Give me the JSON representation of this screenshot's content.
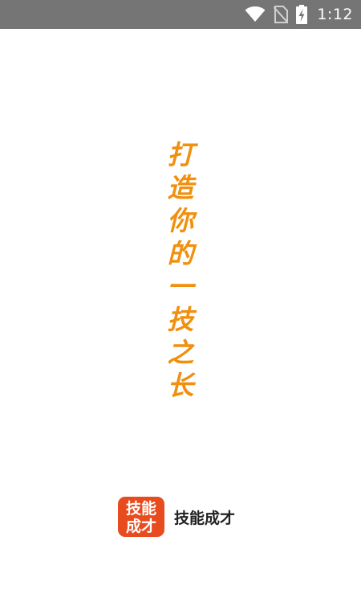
{
  "status_bar": {
    "time": "1:12",
    "icons": [
      "wifi-icon",
      "no-sim-icon",
      "battery-charging-icon"
    ],
    "background": "#757575"
  },
  "slogan": {
    "chars": [
      "打",
      "造",
      "你",
      "的",
      "一",
      "技",
      "之",
      "长"
    ],
    "color": "#f0900e"
  },
  "brand": {
    "logo_line1": "技能",
    "logo_line2": "成才",
    "name": "技能成才",
    "logo_color": "#e84b1e"
  }
}
